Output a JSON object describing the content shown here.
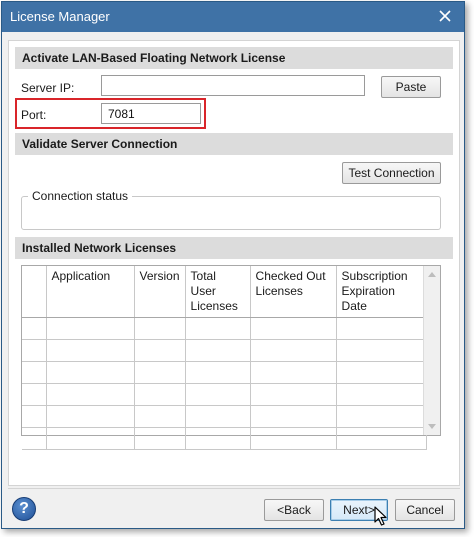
{
  "window": {
    "title": "License Manager"
  },
  "sections": {
    "activate": "Activate LAN-Based Floating Network License",
    "validate": "Validate Server Connection",
    "installed": "Installed Network Licenses"
  },
  "server_ip": {
    "label": "Server IP:",
    "value": ""
  },
  "port": {
    "label": "Port:",
    "value": "7081"
  },
  "buttons": {
    "paste": "Paste",
    "test_connection": "Test Connection",
    "back": "<Back",
    "next": "Next>",
    "cancel": "Cancel"
  },
  "connection_status": {
    "legend": "Connection status",
    "text": ""
  },
  "licenses_table": {
    "columns": [
      "",
      "Application",
      "Version",
      "Total User Licenses",
      "Checked Out Licenses",
      "Subscription Expiration Date"
    ],
    "rows": [
      [
        "",
        "",
        "",
        "",
        "",
        ""
      ],
      [
        "",
        "",
        "",
        "",
        "",
        ""
      ],
      [
        "",
        "",
        "",
        "",
        "",
        ""
      ],
      [
        "",
        "",
        "",
        "",
        "",
        ""
      ],
      [
        "",
        "",
        "",
        "",
        "",
        ""
      ],
      [
        "",
        "",
        "",
        "",
        "",
        ""
      ]
    ]
  },
  "help": {
    "glyph": "?"
  },
  "colors": {
    "titlebar": "#3f72a6",
    "highlight": "#d9252a",
    "section_bg": "#dcdcdc"
  }
}
